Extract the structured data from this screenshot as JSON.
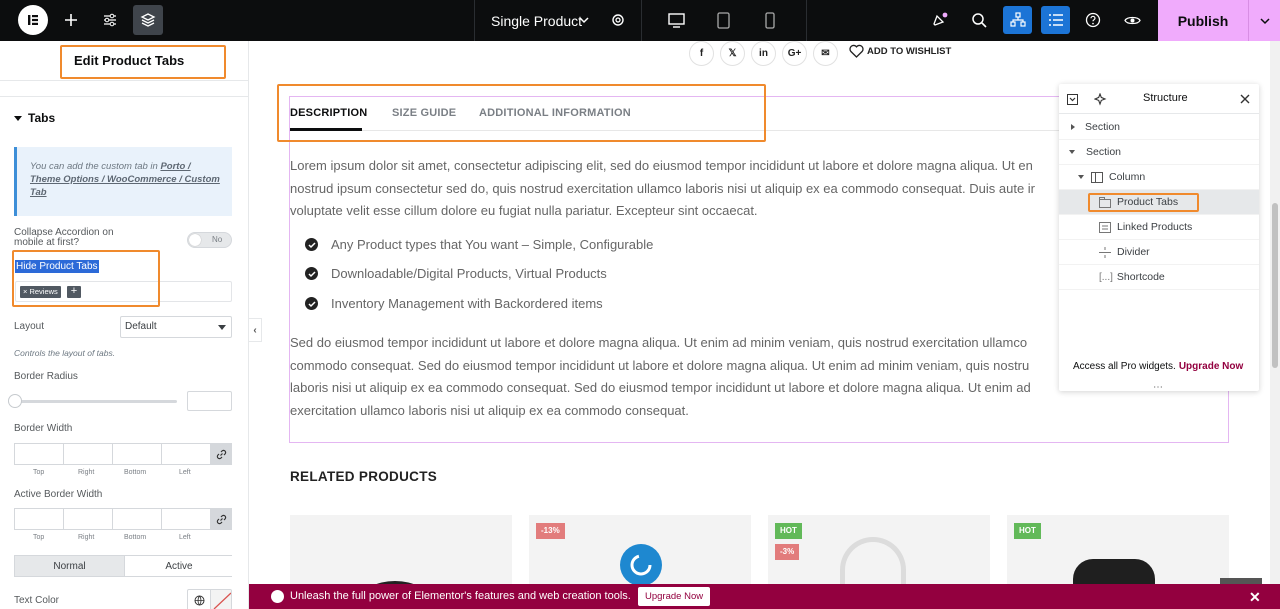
{
  "topbar": {
    "document_title": "Single Product",
    "publish_label": "Publish",
    "icons": [
      "elementor-logo-icon",
      "add-icon",
      "settings-sliders-icon",
      "layers-icon",
      "gear-icon",
      "desktop-icon",
      "tablet-icon",
      "mobile-icon",
      "notification-icon",
      "search-icon",
      "structure-icon",
      "navigator-icon",
      "help-icon",
      "preview-eye-icon",
      "chevron-down-icon"
    ]
  },
  "panel": {
    "title": "Edit Product Tabs",
    "section_title": "Tabs",
    "info_text_prefix": "You can add the custom tab in ",
    "info_link": "Porto / Theme Options / WooCommerce / Custom Tab",
    "collapse_label": "Collapse Accordion on mobile at first?",
    "collapse_toggle": "No",
    "hide_tabs_label": "Hide Product Tabs",
    "hide_tabs_tag": "× Reviews",
    "hide_tabs_add": "+",
    "layout_label": "Layout",
    "layout_value": "Default",
    "layout_note": "Controls the layout of tabs.",
    "border_radius_label": "Border Radius",
    "border_width_label": "Border Width",
    "active_border_width_label": "Active Border Width",
    "dim_top": "Top",
    "dim_right": "Right",
    "dim_bottom": "Bottom",
    "dim_left": "Left",
    "state_normal": "Normal",
    "state_active": "Active",
    "text_color_label": "Text Color",
    "collapse_arrow": "‹"
  },
  "canvas": {
    "add_to_wishlist": "ADD TO WISHLIST",
    "social": [
      "f",
      "𝕏",
      "in",
      "G+",
      "✉"
    ],
    "tabs": [
      "DESCRIPTION",
      "SIZE GUIDE",
      "ADDITIONAL INFORMATION"
    ],
    "para1": [
      "Lorem ipsum dolor sit amet, consectetur adipiscing elit, sed do eiusmod tempor incididunt ut labore et dolore magna aliqua. Ut en",
      "nostrud ipsum consectetur sed do, quis nostrud exercitation ullamco laboris nisi ut aliquip ex ea commodo consequat. Duis aute ir",
      "voluptate velit esse cillum dolore eu fugiat nulla pariatur. Excepteur sint occaecat."
    ],
    "bullets": [
      "Any Product types that You want – Simple, Configurable",
      "Downloadable/Digital Products, Virtual Products",
      "Inventory Management with Backordered items"
    ],
    "para2": [
      "Sed do eiusmod tempor incididunt ut labore et dolore magna aliqua. Ut enim ad minim veniam, quis nostrud exercitation ullamco",
      "commodo consequat. Sed do eiusmod tempor incididunt ut labore et dolore magna aliqua. Ut enim ad minim veniam, quis nostru",
      "laboris nisi ut aliquip ex ea commodo consequat. Sed do eiusmod tempor incididunt ut labore et dolore magna aliqua. Ut enim ad",
      "exercitation ullamco laboris nisi ut aliquip ex ea commodo consequat."
    ],
    "related_title": "RELATED PRODUCTS",
    "badges": {
      "card2": "-13%",
      "card3_hot": "HOT",
      "card3_sale": "-3%",
      "card4_hot": "HOT"
    },
    "badge_colors": {
      "sale": "#e27c7c",
      "hot": "#62b959"
    }
  },
  "structure": {
    "title": "Structure",
    "items": [
      {
        "label": "Section"
      },
      {
        "label": "Section"
      },
      {
        "label": "Column"
      },
      {
        "label": "Product Tabs"
      },
      {
        "label": "Linked Products"
      },
      {
        "label": "Divider"
      },
      {
        "label": "Shortcode"
      }
    ],
    "footer_text": "Access all Pro widgets.",
    "footer_link": "Upgrade Now"
  },
  "banner": {
    "message": "Unleash the full power of Elementor's features and web creation tools.",
    "button": "Upgrade Now",
    "close": "✕"
  },
  "colors": {
    "accent_publish": "#f0abfc",
    "highlight": "#f08a2d",
    "banner": "#93003f",
    "active_blue": "#1c74d6"
  }
}
